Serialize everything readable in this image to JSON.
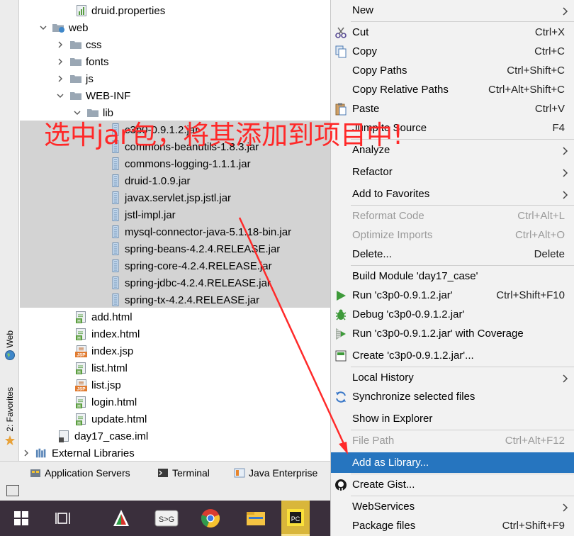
{
  "side_tabs": {
    "web": "Web",
    "favorites": "2: Favorites"
  },
  "tree": [
    {
      "label": "druid.properties",
      "icon": "properties-file-icon",
      "arrow": "none",
      "indent": 1
    },
    {
      "label": "web",
      "icon": "web-folder-icon",
      "arrow": "down",
      "indent": 0
    },
    {
      "label": "css",
      "icon": "folder-icon",
      "arrow": "right",
      "indent": 1
    },
    {
      "label": "fonts",
      "icon": "folder-icon",
      "arrow": "right",
      "indent": 1
    },
    {
      "label": "js",
      "icon": "folder-icon",
      "arrow": "right",
      "indent": 1
    },
    {
      "label": "WEB-INF",
      "icon": "folder-icon",
      "arrow": "down",
      "indent": 1
    },
    {
      "label": "lib",
      "icon": "folder-icon",
      "arrow": "down",
      "indent": 2
    },
    {
      "label": "c3p0-0.9.1.2.jar",
      "icon": "jar-icon",
      "arrow": "none",
      "indent": 3
    },
    {
      "label": "commons-beanutils-1.8.3.jar",
      "icon": "jar-icon",
      "arrow": "none",
      "indent": 3
    },
    {
      "label": "commons-logging-1.1.1.jar",
      "icon": "jar-icon",
      "arrow": "none",
      "indent": 3
    },
    {
      "label": "druid-1.0.9.jar",
      "icon": "jar-icon",
      "arrow": "none",
      "indent": 3
    },
    {
      "label": "javax.servlet.jsp.jstl.jar",
      "icon": "jar-icon",
      "arrow": "none",
      "indent": 3
    },
    {
      "label": "jstl-impl.jar",
      "icon": "jar-icon",
      "arrow": "none",
      "indent": 3
    },
    {
      "label": "mysql-connector-java-5.1.18-bin.jar",
      "icon": "jar-icon",
      "arrow": "none",
      "indent": 3
    },
    {
      "label": "spring-beans-4.2.4.RELEASE.jar",
      "icon": "jar-icon",
      "arrow": "none",
      "indent": 3
    },
    {
      "label": "spring-core-4.2.4.RELEASE.jar",
      "icon": "jar-icon",
      "arrow": "none",
      "indent": 3
    },
    {
      "label": "spring-jdbc-4.2.4.RELEASE.jar",
      "icon": "jar-icon",
      "arrow": "none",
      "indent": 3
    },
    {
      "label": "spring-tx-4.2.4.RELEASE.jar",
      "icon": "jar-icon",
      "arrow": "none",
      "indent": 3
    },
    {
      "label": "add.html",
      "icon": "html-file-icon",
      "arrow": "none",
      "indent": 1
    },
    {
      "label": "index.html",
      "icon": "html-file-icon",
      "arrow": "none",
      "indent": 1
    },
    {
      "label": "index.jsp",
      "icon": "jsp-file-icon",
      "arrow": "none",
      "indent": 1
    },
    {
      "label": "list.html",
      "icon": "html-file-icon",
      "arrow": "none",
      "indent": 1
    },
    {
      "label": "list.jsp",
      "icon": "jsp-file-icon",
      "arrow": "none",
      "indent": 1
    },
    {
      "label": "login.html",
      "icon": "html-file-icon",
      "arrow": "none",
      "indent": 1
    },
    {
      "label": "update.html",
      "icon": "html-file-icon",
      "arrow": "none",
      "indent": 1
    },
    {
      "label": "day17_case.iml",
      "icon": "iml-file-icon",
      "arrow": "none",
      "indent": 0
    },
    {
      "label": "External Libraries",
      "icon": "libraries-icon",
      "arrow": "right",
      "indent": -1
    }
  ],
  "annotation": "选中jar包，将其添加到项目中!",
  "menu": [
    {
      "label": "New",
      "shortcut": "",
      "submenu": true,
      "disabled": false,
      "icon": "",
      "mnemonic": ""
    },
    {
      "label": "Cut",
      "shortcut": "Ctrl+X",
      "submenu": false,
      "disabled": false,
      "icon": "scissors-icon"
    },
    {
      "label": "Copy",
      "shortcut": "Ctrl+C",
      "submenu": false,
      "disabled": false,
      "icon": "copy-icon"
    },
    {
      "label": "Copy Paths",
      "shortcut": "Ctrl+Shift+C",
      "submenu": false,
      "disabled": false,
      "icon": ""
    },
    {
      "label": "Copy Relative Paths",
      "shortcut": "Ctrl+Alt+Shift+C",
      "submenu": false,
      "disabled": false,
      "icon": ""
    },
    {
      "label": "Paste",
      "shortcut": "Ctrl+V",
      "submenu": false,
      "disabled": false,
      "icon": "paste-icon"
    },
    {
      "label": "Jump to Source",
      "shortcut": "F4",
      "submenu": false,
      "disabled": false,
      "icon": ""
    },
    {
      "label": "Analyze",
      "shortcut": "",
      "submenu": true,
      "disabled": false,
      "icon": ""
    },
    {
      "label": "Refactor",
      "shortcut": "",
      "submenu": true,
      "disabled": false,
      "icon": ""
    },
    {
      "label": "Add to Favorites",
      "shortcut": "",
      "submenu": true,
      "disabled": false,
      "icon": ""
    },
    {
      "label": "Reformat Code",
      "shortcut": "Ctrl+Alt+L",
      "submenu": false,
      "disabled": true,
      "icon": ""
    },
    {
      "label": "Optimize Imports",
      "shortcut": "Ctrl+Alt+O",
      "submenu": false,
      "disabled": true,
      "icon": ""
    },
    {
      "label": "Delete...",
      "shortcut": "Delete",
      "submenu": false,
      "disabled": false,
      "icon": ""
    },
    {
      "label": "Build Module 'day17_case'",
      "shortcut": "",
      "submenu": false,
      "disabled": false,
      "icon": ""
    },
    {
      "label": "Run 'c3p0-0.9.1.2.jar'",
      "shortcut": "Ctrl+Shift+F10",
      "submenu": false,
      "disabled": false,
      "icon": "run-icon"
    },
    {
      "label": "Debug 'c3p0-0.9.1.2.jar'",
      "shortcut": "",
      "submenu": false,
      "disabled": false,
      "icon": "debug-icon"
    },
    {
      "label": "Run 'c3p0-0.9.1.2.jar' with Coverage",
      "shortcut": "",
      "submenu": false,
      "disabled": false,
      "icon": "coverage-icon"
    },
    {
      "label": "Create 'c3p0-0.9.1.2.jar'...",
      "shortcut": "",
      "submenu": false,
      "disabled": false,
      "icon": "create-config-icon"
    },
    {
      "label": "Local History",
      "shortcut": "",
      "submenu": true,
      "disabled": false,
      "icon": ""
    },
    {
      "label": "Synchronize selected files",
      "shortcut": "",
      "submenu": false,
      "disabled": false,
      "icon": "sync-icon"
    },
    {
      "label": "Show in Explorer",
      "shortcut": "",
      "submenu": false,
      "disabled": false,
      "icon": ""
    },
    {
      "label": "File Path",
      "shortcut": "Ctrl+Alt+F12",
      "submenu": false,
      "disabled": true,
      "icon": ""
    },
    {
      "label": "Add as Library...",
      "shortcut": "",
      "submenu": false,
      "disabled": false,
      "icon": "",
      "highlighted": true
    },
    {
      "label": "Create Gist...",
      "shortcut": "",
      "submenu": false,
      "disabled": false,
      "icon": "github-icon"
    },
    {
      "label": "WebServices",
      "shortcut": "",
      "submenu": true,
      "disabled": false,
      "icon": ""
    },
    {
      "label": "Package files",
      "shortcut": "Ctrl+Shift+F9",
      "submenu": false,
      "disabled": false,
      "icon": ""
    }
  ],
  "bottom_tabs": {
    "app_servers": "Application Servers",
    "terminal": "Terminal",
    "java_enterprise": "Java Enterprise"
  },
  "taskbar_apps": [
    "windows-start-icon",
    "task-view-icon",
    "app-icon-1",
    "app-icon-2",
    "chrome-icon",
    "file-explorer-icon",
    "pycharm-icon"
  ]
}
